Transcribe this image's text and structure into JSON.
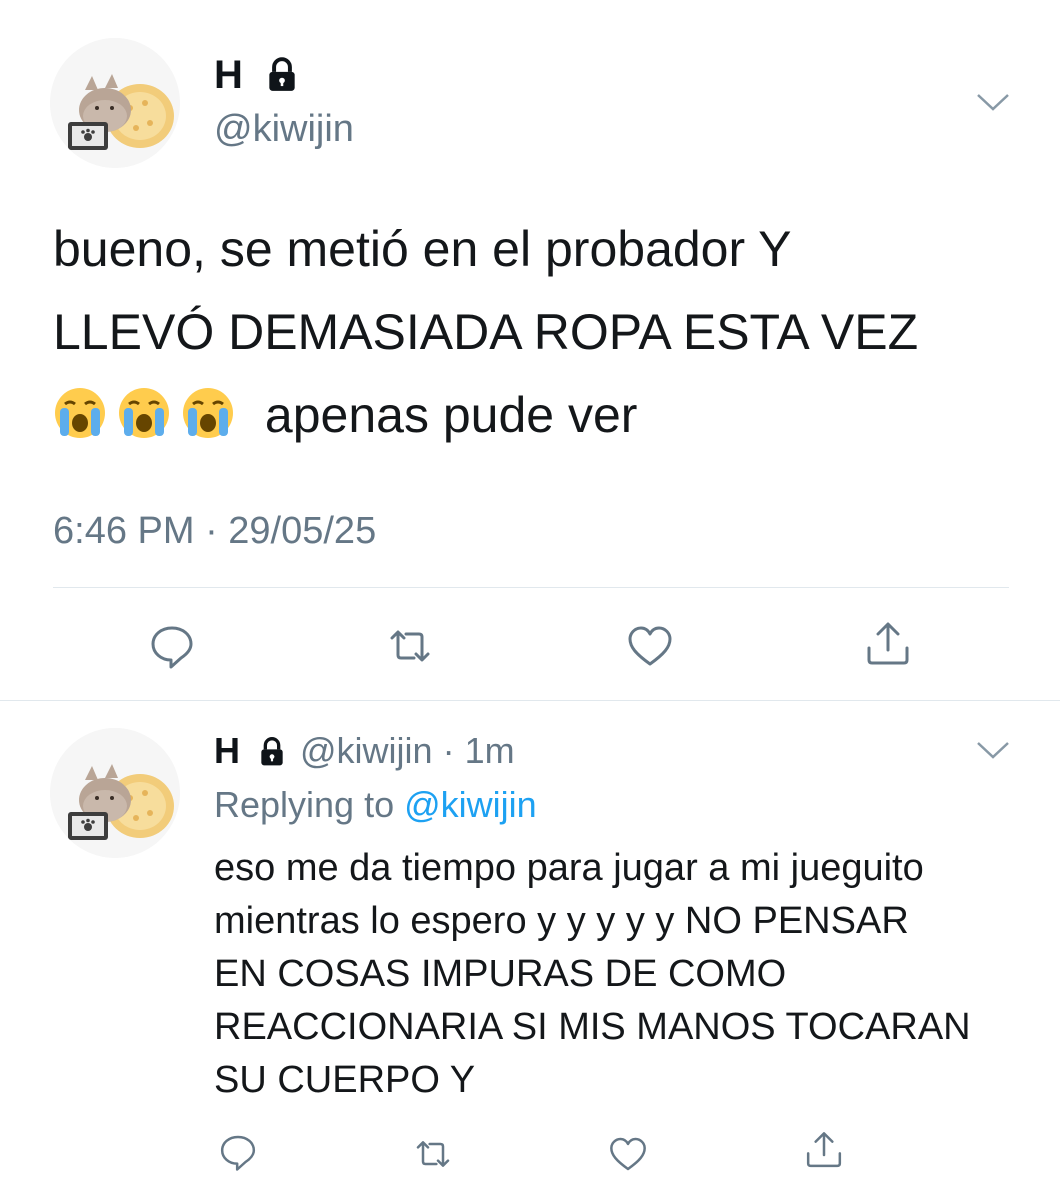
{
  "tweet": {
    "display_name": "H",
    "handle": "@kiwijin",
    "text_line1": "bueno, se metió en el probador Y",
    "text_line2": "LLEVÓ DEMASIADA ROPA ESTA VEZ",
    "text_line3": "apenas pude ver",
    "emojis": [
      "loudly-crying-face",
      "loudly-crying-face",
      "loudly-crying-face"
    ],
    "timestamp": "6:46 PM · 29/05/25"
  },
  "reply": {
    "display_name": "H",
    "handle": "@kiwijin",
    "separator": " · ",
    "time_ago": "1m",
    "replying_prefix": "Replying to ",
    "replying_mention": "@kiwijin",
    "text_lines": [
      "eso me da tiempo para jugar a mi jueguito",
      "mientras lo espero y y y y y NO PENSAR",
      "EN COSAS IMPURAS DE COMO",
      "REACCIONARIA SI MIS MANOS TOCARAN",
      "SU CUERPO Y"
    ]
  },
  "actions": [
    "reply-icon",
    "retweet-icon",
    "like-icon",
    "share-icon"
  ],
  "colors": {
    "text": "#14171a",
    "secondary": "#657786",
    "link": "#1da1f2",
    "divider": "#e1e8ed"
  }
}
